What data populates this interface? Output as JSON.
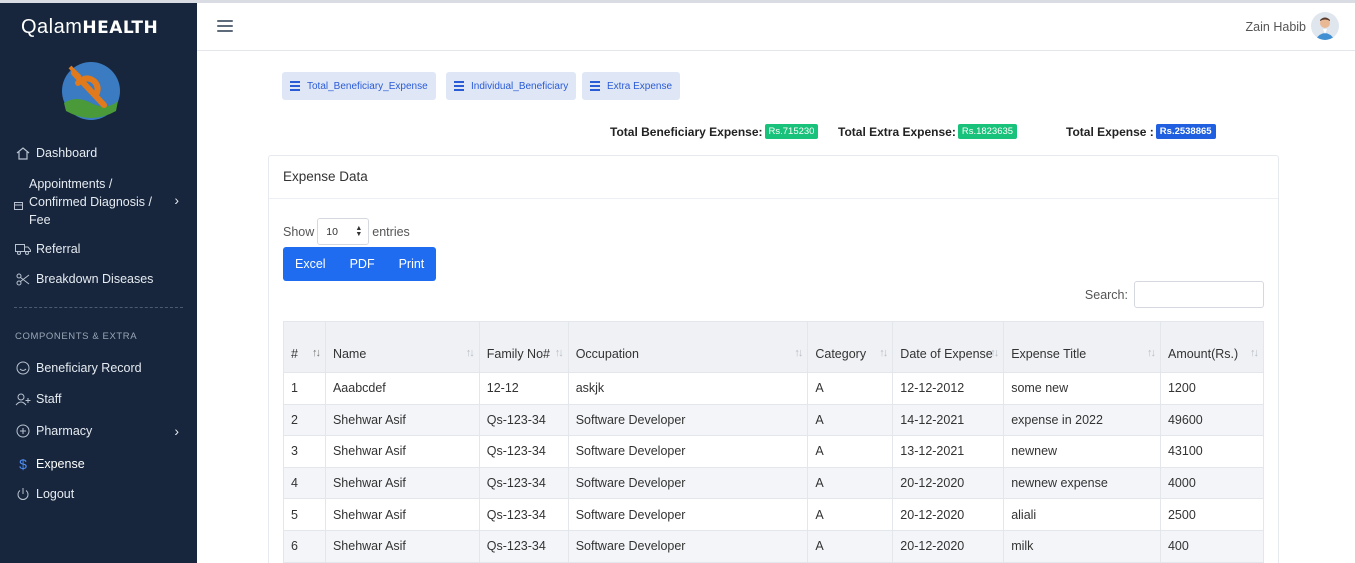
{
  "sidebar": {
    "brand_light": "Qalam",
    "brand_bold": "HEALTH",
    "items": [
      {
        "label": "Dashboard",
        "icon": "home-icon"
      },
      {
        "label": "Appointments / Confirmed Diagnosis / Fee",
        "icon": "calendar-icon"
      },
      {
        "label": "Referral",
        "icon": "truck-icon"
      },
      {
        "label": "Breakdown Diseases",
        "icon": "scissors-icon"
      }
    ],
    "section_title": "COMPONENTS & EXTRA",
    "items2": [
      {
        "label": "Beneficiary Record",
        "icon": "smile-icon"
      },
      {
        "label": "Staff",
        "icon": "user-plus-icon"
      },
      {
        "label": "Pharmacy",
        "icon": "plus-circle-icon"
      },
      {
        "label": "Expense",
        "icon": "dollar-icon"
      },
      {
        "label": "Logout",
        "icon": "power-icon"
      }
    ]
  },
  "header": {
    "user_name": "Zain Habib"
  },
  "tabs": [
    "Total_Beneficiary_Expense",
    "Individual_Beneficiary",
    "Extra Expense"
  ],
  "totals": [
    {
      "label": "Total Beneficiary Expense:",
      "value": "Rs.715230"
    },
    {
      "label": "Total Extra Expense:",
      "value": "Rs.1823635"
    },
    {
      "label": "Total Expense :",
      "value": "Rs.2538865"
    }
  ],
  "card": {
    "title": "Expense Data",
    "show_label": "Show",
    "entries_value": "10",
    "entries_label": "entries",
    "buttons": [
      "Excel",
      "PDF",
      "Print"
    ],
    "search_label": "Search:"
  },
  "table": {
    "headers": [
      "#",
      "Name",
      "Family No#",
      "Occupation",
      "Category",
      "Date of Expense",
      "Expense Title",
      "Amount(Rs.)"
    ],
    "rows": [
      [
        "1",
        "Aaabcdef",
        "12-12",
        "askjk",
        "A",
        "12-12-2012",
        "some new",
        "1200"
      ],
      [
        "2",
        "Shehwar Asif",
        "Qs-123-34",
        "Software Developer",
        "A",
        "14-12-2021",
        "expense in 2022",
        "49600"
      ],
      [
        "3",
        "Shehwar Asif",
        "Qs-123-34",
        "Software Developer",
        "A",
        "13-12-2021",
        "newnew",
        "43100"
      ],
      [
        "4",
        "Shehwar Asif",
        "Qs-123-34",
        "Software Developer",
        "A",
        "20-12-2020",
        "newnew expense",
        "4000"
      ],
      [
        "5",
        "Shehwar Asif",
        "Qs-123-34",
        "Software Developer",
        "A",
        "20-12-2020",
        "aliali",
        "2500"
      ],
      [
        "6",
        "Shehwar Asif",
        "Qs-123-34",
        "Software Developer",
        "A",
        "20-12-2020",
        "milk",
        "400"
      ]
    ]
  },
  "colors": {
    "sidebar_bg": "#17263c",
    "accent_blue": "#1f6cf0",
    "badge_green": "#19c27a"
  }
}
